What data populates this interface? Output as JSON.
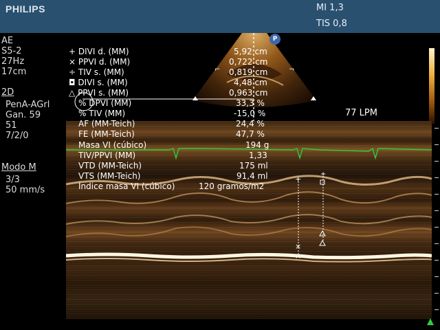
{
  "header": {
    "brand": "PHILIPS",
    "mi": "MI 1,3",
    "tis": "TIS 0,8"
  },
  "left_panel": {
    "mode_top": "AE",
    "probe": "S5-2",
    "frequency": "27Hz",
    "depth": "17cm",
    "section_2d": "2D",
    "preset": "PenA-AGrl",
    "gain": "Gan. 59",
    "value_51": "51",
    "values_line": "7/2/0",
    "section_mmode": "Modo M",
    "mmode_page": "3/3",
    "sweep_speed": "50 mm/s"
  },
  "heart_rate": "77 LPM",
  "probe_badge": "P",
  "measurements": [
    {
      "marker": "+",
      "label": "DIVI d. (MM)",
      "value": "5,92 cm"
    },
    {
      "marker": "×",
      "label": "PPVI d. (MM)",
      "value": "0,722 cm"
    },
    {
      "marker": "÷",
      "label": "TIV s. (MM)",
      "value": "0,819 cm"
    },
    {
      "marker": "◘",
      "label": "DIVI s. (MM)",
      "value": "4,48 cm"
    },
    {
      "marker": "△",
      "label": "PPVI s. (MM)",
      "value": "0,963 cm"
    },
    {
      "marker": "",
      "label": "% DPVI (MM)",
      "value": "33,3 %"
    },
    {
      "marker": "",
      "label": "% TIV (MM)",
      "value": "-15,0 %"
    },
    {
      "marker": "",
      "label": "AF (MM-Teich)",
      "value": "24,4 %"
    },
    {
      "marker": "",
      "label": "FE (MM-Teich)",
      "value": "47,7 %"
    },
    {
      "marker": "",
      "label": "Masa VI (cúbico)",
      "value": "194 g"
    },
    {
      "marker": "",
      "label": "TIV/PPVI (MM)",
      "value": "1,33"
    },
    {
      "marker": "",
      "label": "VTD (MM-Teich)",
      "value": "175 ml"
    },
    {
      "marker": "",
      "label": "VTS (MM-Teich)",
      "value": "91,4 ml"
    },
    {
      "marker": "",
      "label": "Índice masa VI (cúbico)",
      "value": "120 gramos/m2"
    }
  ],
  "colors": {
    "header_bg": "#2a5070",
    "ecg_trace": "#2ecc40",
    "text": "#ffffff",
    "echo_tint": "#c08040"
  },
  "icons": [
    "plus-marker-icon",
    "x-marker-icon",
    "divide-marker-icon",
    "square-marker-icon",
    "triangle-marker-icon",
    "green-triangle-icon"
  ]
}
